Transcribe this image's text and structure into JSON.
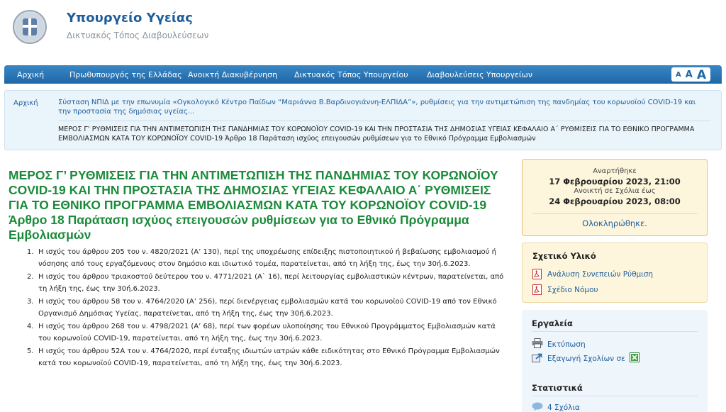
{
  "header": {
    "site_title": "Υπουργείο Υγείας",
    "site_subtitle": "Δικτυακός Τόπος Διαβουλεύσεων"
  },
  "nav": {
    "items": [
      "Αρχική",
      "Πρωθυπουργός της Ελλάδας",
      "Ανοικτή Διακυβέρνηση",
      "Δικτυακός Τόπος Υπουργείου",
      "Διαβουλεύσεις Υπουργείων"
    ],
    "font_sizes": [
      "A",
      "A",
      "A"
    ]
  },
  "breadcrumb": {
    "home": "Αρχική",
    "parent": "Σύσταση ΝΠΙΔ με την επωνυμία «Ογκολογικό Κέντρο Παίδων “Μαριάννα Β.Βαρδινογιάννη-ΕΛΠΙΔΑ”», ρυθμίσεις για την αντιμετώπιση της πανδημίας του κορωνοϊού COVID-19 και την προστασία της δημόσιας υγείας...",
    "current": "ΜΕΡΟΣ Γ’ ΡΥΘΜΙΣΕΙΣ ΓΙΑ ΤΗΝ ΑΝΤΙΜΕΤΩΠΙΣΗ ΤΗΣ ΠΑΝΔΗΜΙΑΣ ΤΟΥ ΚΟΡΩΝΟΪΟΥ COVID-19 ΚΑΙ ΤΗΝ ΠΡΟΣΤΑΣΙΑ ΤΗΣ ΔΗΜΟΣΙΑΣ ΥΓΕΙΑΣ ΚΕΦΑΛΑΙΟ Α΄ ΡΥΘΜΙΣΕΙΣ ΓΙΑ ΤΟ ΕΘΝΙΚΟ ΠΡΟΓΡΑΜΜΑ ΕΜΒΟΛΙΑΣΜΩΝ ΚΑΤΑ ΤΟΥ ΚΟΡΩΝΟΪΟΥ COVID-19 Άρθρο 18 Παράταση ισχύος επειγουσών ρυθμίσεων για το Εθνικό Πρόγραμμα Εμβολιασμών"
  },
  "article": {
    "title": "ΜΕΡΟΣ Γ’ ΡΥΘΜΙΣΕΙΣ ΓΙΑ ΤΗΝ ΑΝΤΙΜΕΤΩΠΙΣΗ ΤΗΣ ΠΑΝΔΗΜΙΑΣ ΤΟΥ ΚΟΡΩΝΟΪΟΥ COVID-19 ΚΑΙ ΤΗΝ ΠΡΟΣΤΑΣΙΑ ΤΗΣ ΔΗΜΟΣΙΑΣ ΥΓΕΙΑΣ ΚΕΦΑΛΑΙΟ Α΄ ΡΥΘΜΙΣΕΙΣ ΓΙΑ ΤΟ ΕΘΝΙΚΟ ΠΡΟΓΡΑΜΜΑ ΕΜΒΟΛΙΑΣΜΩΝ ΚΑΤΑ ΤΟΥ ΚΟΡΩΝΟΪΟΥ COVID-19 Άρθρο 18 Παράταση ισχύος επειγουσών ρυθμίσεων για το Εθνικό Πρόγραμμα Εμβολιασμών",
    "paragraphs": [
      {
        "num": "1.",
        "text": "Η ισχύς του άρθρου 205 του ν. 4820/2021 (Α’ 130), περί της υποχρέωσης επίδειξης πιστοποιητικού ή βεβαίωσης εμβολιασμού ή νόσησης από τους εργαζόμενους στον δημόσιο και ιδιωτικό τομέα, παρατείνεται, από τη λήξη της, έως την 30ή.6.2023."
      },
      {
        "num": "2.",
        "text": "Η ισχύς του άρθρου τριακοστού δεύτερου του ν. 4771/2021 (Α` 16), περί λειτουργίας εμβολιαστικών κέντρων, παρατείνεται, από τη λήξη της, έως την 30ή.6.2023."
      },
      {
        "num": "3.",
        "text": "Η ισχύς του άρθρου 58 του ν. 4764/2020 (Α’ 256), περί διενέργειας εμβολιασμών κατά του κορωνοϊού COVID-19 από τον Εθνικό Οργανισμό Δημόσιας Υγείας, παρατείνεται, από τη λήξη της, έως την 30ή.6.2023."
      },
      {
        "num": "4.",
        "text": "Η ισχύς του άρθρου 268 του ν. 4798/2021 (Α’ 68), περί των φορέων υλοποίησης του Εθνικού Προγράμματος Εμβολιασμών κατά του κορωνοϊού COVID-19, παρατείνεται, από τη λήξη της, έως την 30ή.6.2023."
      },
      {
        "num": "5.",
        "text": "Η ισχύς του άρθρου 52Α του ν. 4764/2020, περί ένταξης ιδιωτών ιατρών κάθε ειδικότητας στο Εθνικό Πρόγραμμα Εμβολιασμών κατά του κορωνοϊού COVID-19, παρατείνεται, από τη λήξη της, έως την 30ή.6.2023."
      }
    ]
  },
  "post_info": {
    "posted_label": "Αναρτήθηκε",
    "posted_date": "17 Φεβρουαρίου 2023, 21:00",
    "open_label": "Ανοικτή σε Σχόλια έως",
    "open_date": "24 Φεβρουαρίου 2023, 08:00",
    "status": "Ολοκληρώθηκε."
  },
  "related": {
    "title": "Σχετικό Υλικό",
    "items": [
      "Ανάλυση Συνεπειών Ρύθμιση",
      "Σχέδιο Νόμου"
    ]
  },
  "tools": {
    "title": "Εργαλεία",
    "print": "Εκτύπωση",
    "export": "Εξαγωγή Σχολίων σε"
  },
  "stats": {
    "title": "Στατιστικά",
    "comments": "4 Σχόλια"
  },
  "colors": {
    "nav": "#1f67a6",
    "title_green": "#1b8a3a",
    "link_blue": "#1e5d9b",
    "post_bg": "#fdf6dd"
  }
}
